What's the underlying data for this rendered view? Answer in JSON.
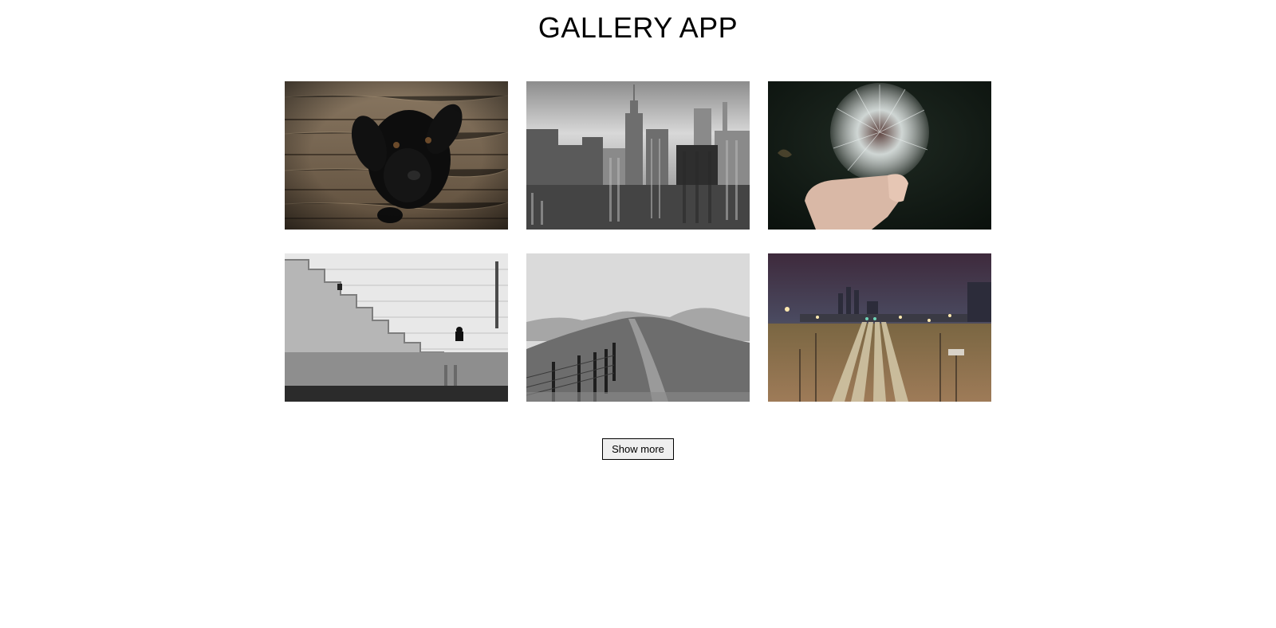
{
  "header": {
    "title": "GALLERY APP"
  },
  "gallery": {
    "photos": [
      {
        "subject": "black puppy on wooden floor",
        "icon": "dog-photo"
      },
      {
        "subject": "black and white city skyline",
        "icon": "city-photo"
      },
      {
        "subject": "hand holding dandelion",
        "icon": "dandelion-photo"
      },
      {
        "subject": "person sitting on stone stairs",
        "icon": "stairs-photo"
      },
      {
        "subject": "hill path with fence",
        "icon": "hill-photo"
      },
      {
        "subject": "railway tracks at night",
        "icon": "railway-photo"
      }
    ]
  },
  "actions": {
    "show_more_label": "Show more"
  }
}
